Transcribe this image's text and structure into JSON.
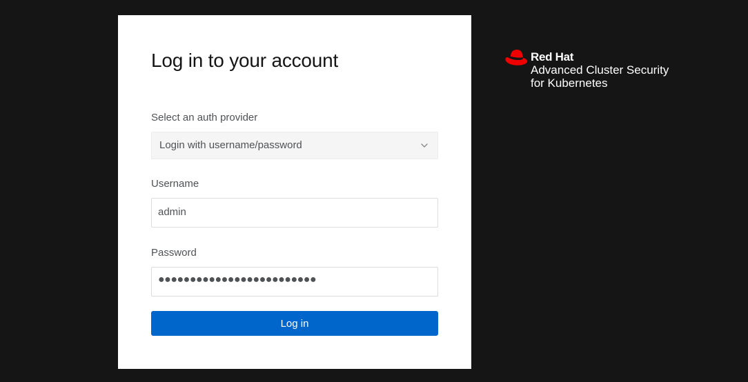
{
  "login": {
    "title": "Log in to your account",
    "auth_provider_label": "Select an auth provider",
    "auth_provider_value": "Login with username/password",
    "username_label": "Username",
    "username_value": "admin",
    "password_label": "Password",
    "password_mask": "●●●●●●●●●●●●●●●●●●●●●●●●●",
    "login_button_label": "Log in"
  },
  "brand": {
    "company": "Red Hat",
    "product_line1": "Advanced Cluster Security",
    "product_line2": "for Kubernetes",
    "logo_icon": "red-hat-fedora-icon"
  },
  "colors": {
    "page_background": "#151515",
    "card_background": "#ffffff",
    "primary_button": "#0066cc",
    "brand_red": "#ee0000",
    "text_muted": "#4f5255"
  },
  "icons": {
    "select_caret": "chevron-down-icon"
  }
}
